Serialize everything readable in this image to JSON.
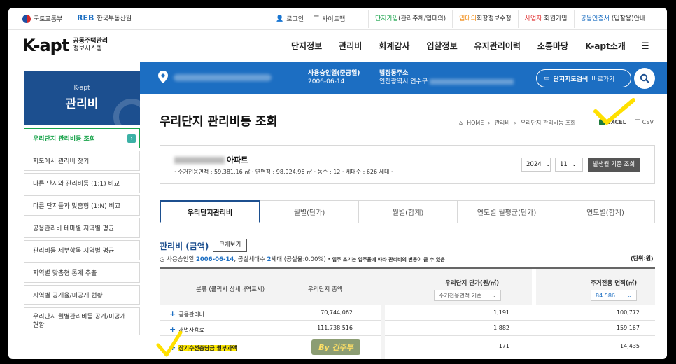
{
  "topbar": {
    "mol_label": "국토교통부",
    "reb_mark": "REB",
    "reb_label": "한국부동산원",
    "login": "로그인",
    "sitemap": "사이트맵",
    "tabs": [
      {
        "pre": "단지가입",
        "post": "(관리주체/입대의)"
      },
      {
        "pre": "입대의",
        "post": "회장정보수정"
      },
      {
        "pre": "사업자",
        "post": " 회원가입"
      },
      {
        "pre": "공동인증서",
        "post": " (입찰용)안내"
      }
    ]
  },
  "brand": {
    "logo": "K-apt",
    "line1": "공동주택관리",
    "line2": "정보시스템"
  },
  "nav": [
    "단지정보",
    "관리비",
    "회계감사",
    "입찰정보",
    "유지관리이력",
    "소통마당",
    "K-apt소개"
  ],
  "band": {
    "approve_label": "사용승인일(준공일)",
    "approve_date": "2006-06-14",
    "address_label": "법정동주소",
    "address_value": "인천광역시 연수구",
    "map_search_bold": "단지지도검색",
    "map_search_rest": " 바로가기"
  },
  "sidebar": {
    "small": "K-apt",
    "title": "관리비",
    "items": [
      "우리단지 관리비등 조회",
      "지도에서 관리비 찾기",
      "다른 단지와 관리비등 (1:1) 비교",
      "다른 단지들과 맞춤형 (1:N) 비교",
      "공용관리비 테마별 지역별 평균",
      "관리비등 세부항목 지역별 평균",
      "지역별 맞춤형 통계 추출",
      "지역별 공개율/미공개 현황",
      "우리단지 월별관리비등 공개/미공개 현황"
    ]
  },
  "page": {
    "title": "우리단지 관리비등 조회",
    "breadcrumb": [
      "HOME",
      "관리비",
      "우리단지 관리비등 조회"
    ],
    "excel": "EXCEL",
    "csv": "CSV"
  },
  "apt": {
    "name_suffix": "아파트",
    "meta": "· 주거전용면적 : 59,381.16 ㎡   · 연면적 : 98,924.96 ㎡   · 동수 : 12   · 세대수 : 626 세대   ·",
    "year": "2024",
    "month": "11",
    "query_button": "발생월 기준 조회"
  },
  "tabs": [
    "우리단지관리비",
    "월별(단가)",
    "월별(합계)",
    "연도별 월평균(단가)",
    "연도별(합계)"
  ],
  "section": {
    "title": "관리비 (금액)",
    "big_button": "크게보기",
    "info_pre": "사용승인일 ",
    "info_date": "2006-06-14",
    "info_mid": ", 공실세대수 ",
    "info_count": "2",
    "info_post": "세대 (공실율:0.00%)",
    "info_note": "* 입주 초기는 입주율에 따라 관리비의 변동이 클 수 있음",
    "unit": "(단위:원)"
  },
  "table": {
    "headers": [
      "분류 (클릭시 상세내역표시)",
      "우리단지 총액",
      "우리단지 단가(원/㎡)",
      "주거전용 면적(㎡)"
    ],
    "unit_select": "주거전용면적 기준",
    "area_select": "84.586",
    "rows": [
      {
        "name": "공용관리비",
        "total": "70,744,062",
        "unit_price": "1,191",
        "area_cost": "100,772"
      },
      {
        "name": "개별사용료",
        "total": "111,738,516",
        "unit_price": "1,882",
        "area_cost": "159,167"
      },
      {
        "name": "장기수선충당금 월부과액",
        "total": "",
        "unit_price": "171",
        "area_cost": "14,435"
      }
    ]
  },
  "watermark": "By 건주부",
  "colors": {
    "brand_blue": "#1c6ec2",
    "navy": "#1c4f8f",
    "green": "#18a34a",
    "highlight": "#ffea00"
  }
}
